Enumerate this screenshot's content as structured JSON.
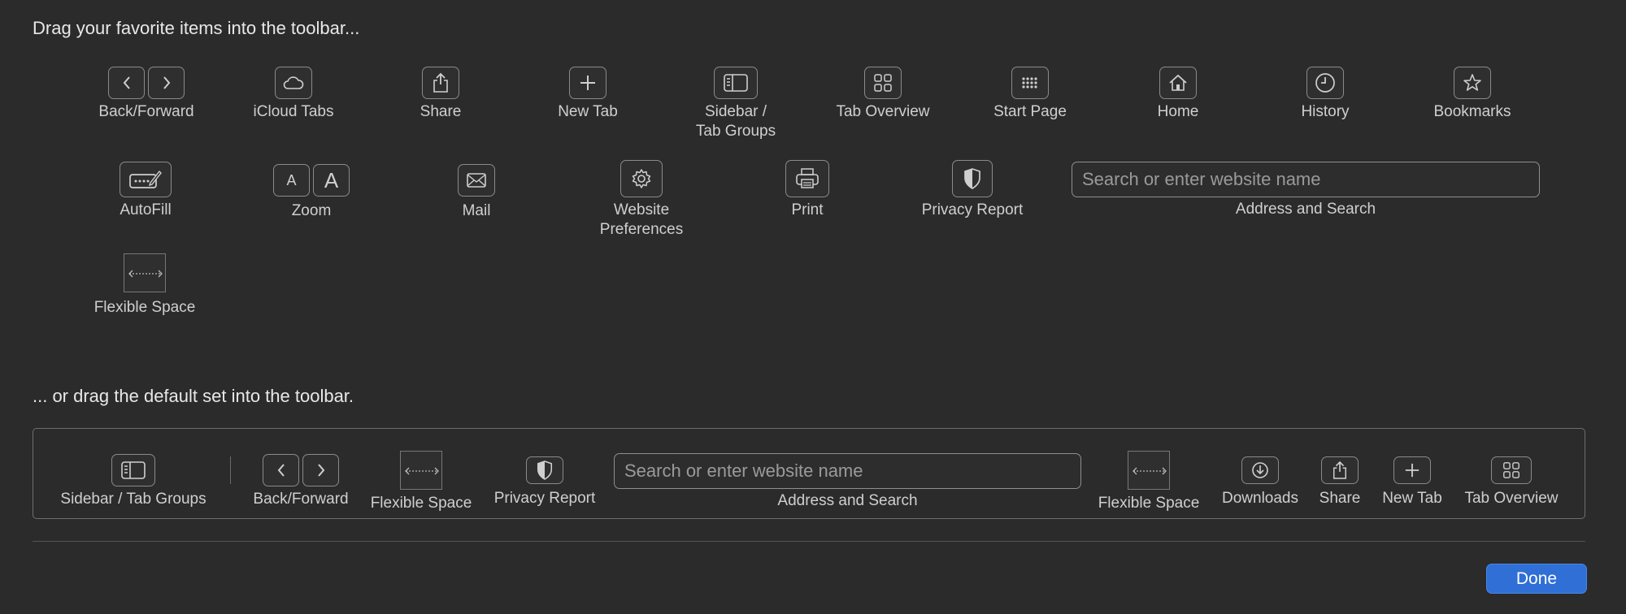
{
  "palette_heading": "Drag your favorite items into the toolbar...",
  "default_heading": "... or drag the default set into the toolbar.",
  "palette": {
    "back_forward": "Back/Forward",
    "icloud_tabs": "iCloud Tabs",
    "share": "Share",
    "new_tab": "New Tab",
    "sidebar_line1": "Sidebar /",
    "sidebar_line2": "Tab Groups",
    "tab_overview": "Tab Overview",
    "start_page": "Start Page",
    "home": "Home",
    "history": "History",
    "bookmarks": "Bookmarks",
    "autofill": "AutoFill",
    "zoom": "Zoom",
    "zoom_small": "A",
    "zoom_large": "A",
    "mail": "Mail",
    "website_prefs_line1": "Website",
    "website_prefs_line2": "Preferences",
    "print": "Print",
    "privacy_report": "Privacy Report",
    "address_placeholder": "Search or enter website name",
    "address_label": "Address and Search",
    "flexible_space": "Flexible Space"
  },
  "default_set": {
    "sidebar": "Sidebar / Tab Groups",
    "back_forward": "Back/Forward",
    "flexible_space_1": "Flexible Space",
    "privacy_report": "Privacy Report",
    "address_placeholder": "Search or enter website name",
    "address_label": "Address and Search",
    "flexible_space_2": "Flexible Space",
    "downloads": "Downloads",
    "share": "Share",
    "new_tab": "New Tab",
    "tab_overview": "Tab Overview"
  },
  "done_label": "Done",
  "colors": {
    "background": "#2b2b2b",
    "accent": "#2f6fd6"
  }
}
